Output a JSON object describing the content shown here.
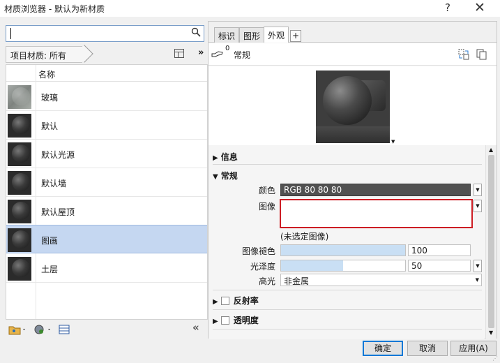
{
  "window": {
    "title": "材质浏览器 - 默认为新材质",
    "help": "?",
    "close": "✕"
  },
  "left": {
    "search": {
      "value": "",
      "placeholder": ""
    },
    "breadcrumb": "项目材质: 所有",
    "more": "»",
    "list_header": "名称",
    "materials": [
      {
        "name": "玻璃",
        "thumb": "glass"
      },
      {
        "name": "默认",
        "thumb": "dark-sphere"
      },
      {
        "name": "默认光源",
        "thumb": "dark-sphere"
      },
      {
        "name": "默认墙",
        "thumb": "dark-sphere"
      },
      {
        "name": "默认屋顶",
        "thumb": "dark-sphere"
      },
      {
        "name": "图画",
        "thumb": "dark-sphere",
        "selected": true
      },
      {
        "name": "土层",
        "thumb": "dark-sphere"
      }
    ],
    "collapse": "«"
  },
  "right": {
    "tabs": [
      "标识",
      "图形",
      "外观"
    ],
    "active_tab": "外观",
    "add_tab": "+",
    "asset": {
      "count": "0",
      "name": "常规"
    },
    "sections": {
      "info": "信息",
      "general": "常规",
      "reflectivity": "反射率",
      "transparency": "透明度"
    },
    "props": {
      "color_label": "颜色",
      "color_value": "RGB 80 80 80",
      "image_label": "图像",
      "image_none": "(未选定图像)",
      "fade_label": "图像褪色",
      "fade_value": "100",
      "fade_fraction": 1.0,
      "gloss_label": "光泽度",
      "gloss_value": "50",
      "gloss_fraction": 0.5,
      "highlight_label": "高光",
      "highlight_value": "非金属"
    }
  },
  "buttons": {
    "ok": "确定",
    "cancel": "取消",
    "apply": "应用(A)"
  },
  "colors": {
    "selection": "#c5d7f1",
    "image_highlight": "#cd1d24",
    "color_swatch": "#515151",
    "ok_border": "#0078d7"
  }
}
